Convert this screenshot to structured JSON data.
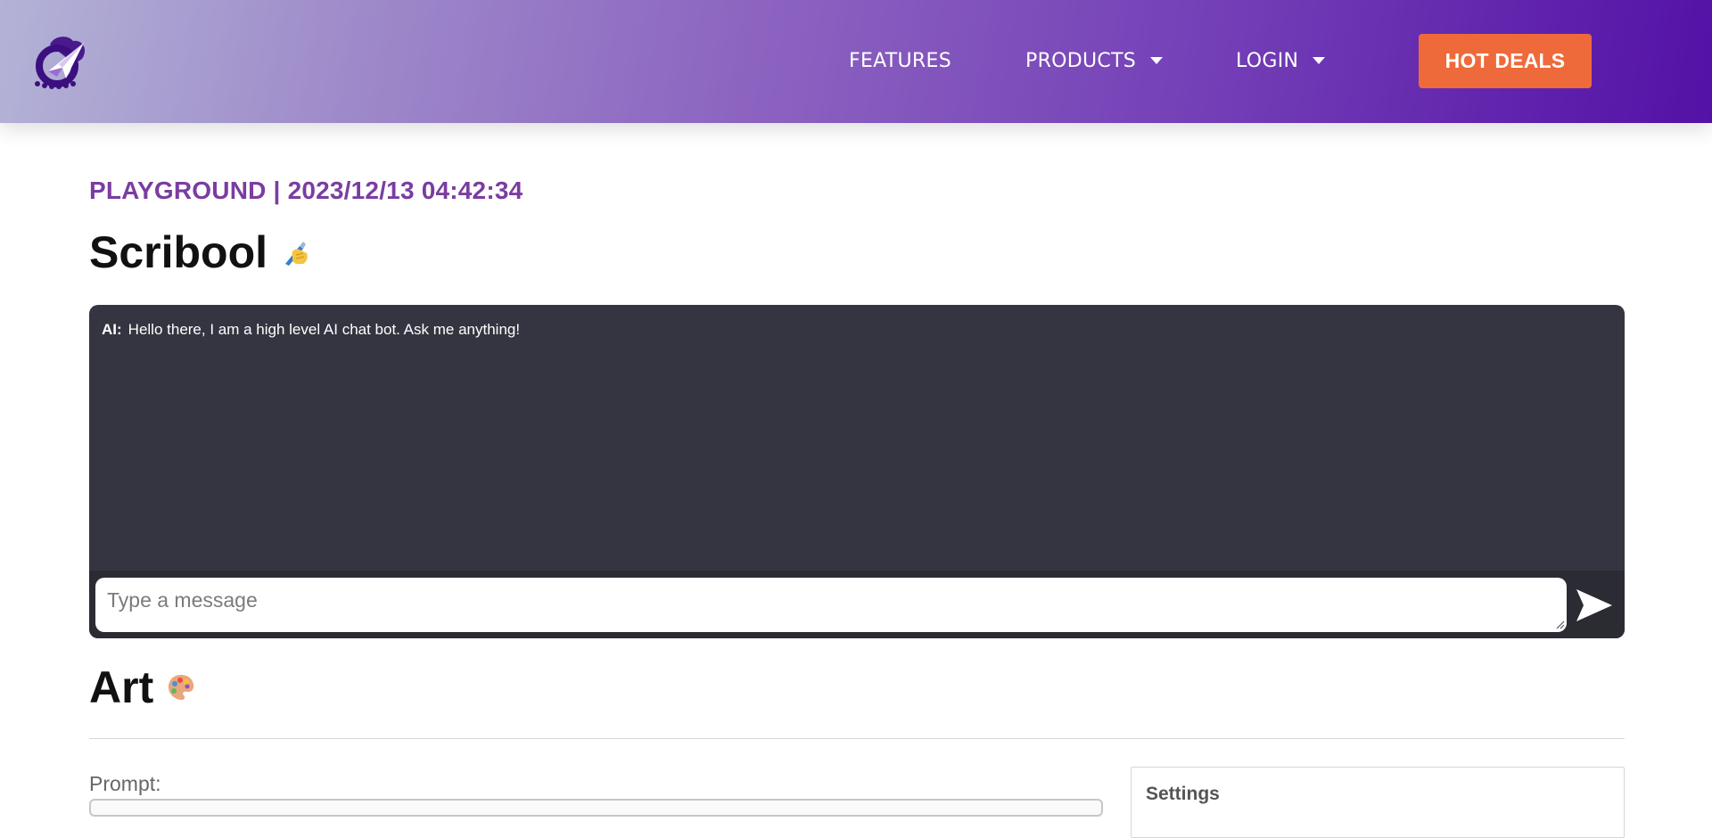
{
  "header": {
    "logo_icon": "paper-plane-rocket-logo",
    "nav": [
      {
        "label": "FEATURES",
        "has_dropdown": false
      },
      {
        "label": "PRODUCTS",
        "has_dropdown": true
      },
      {
        "label": "LOGIN",
        "has_dropdown": true
      }
    ],
    "cta_label": "HOT DEALS",
    "colors": {
      "gradient_start": "#b3b3d6",
      "gradient_end": "#5411a6",
      "cta": "#ef6a3b"
    }
  },
  "page": {
    "section": "PLAYGROUND",
    "separator": "|",
    "timestamp": "2023/12/13 04:42:34",
    "accent_color": "#7a3da1"
  },
  "scribool": {
    "title": "Scribool",
    "title_icon": "writing-hand-icon",
    "messages": [
      {
        "speaker": "AI:",
        "text": "Hello there, I am a high level AI chat bot. Ask me anything!"
      }
    ],
    "input_placeholder": "Type a message",
    "send_icon": "send-icon",
    "panel_color": "#353541"
  },
  "art": {
    "title": "Art",
    "title_icon": "palette-icon",
    "prompt_label": "Prompt:",
    "settings_label": "Settings"
  }
}
